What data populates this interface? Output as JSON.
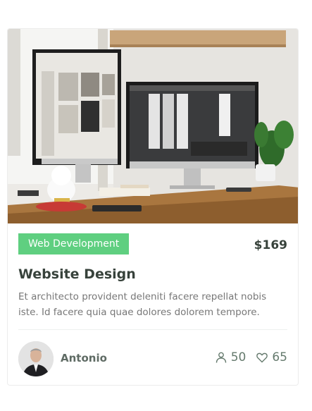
{
  "course": {
    "category": "Web Development",
    "price": "$169",
    "title": "Website Design",
    "description": "Et architecto provident deleniti facere repellat nobis iste. Id facere quia quae dolores dolorem tempore.",
    "trainer": {
      "name": "Antonio"
    },
    "stats": {
      "students": "50",
      "likes": "65"
    }
  },
  "colors": {
    "badge": "#5fcf80",
    "title": "#37423b",
    "text": "#777777",
    "icon": "#657a6d"
  },
  "icons": {
    "students": "user-icon",
    "likes": "heart-icon"
  }
}
